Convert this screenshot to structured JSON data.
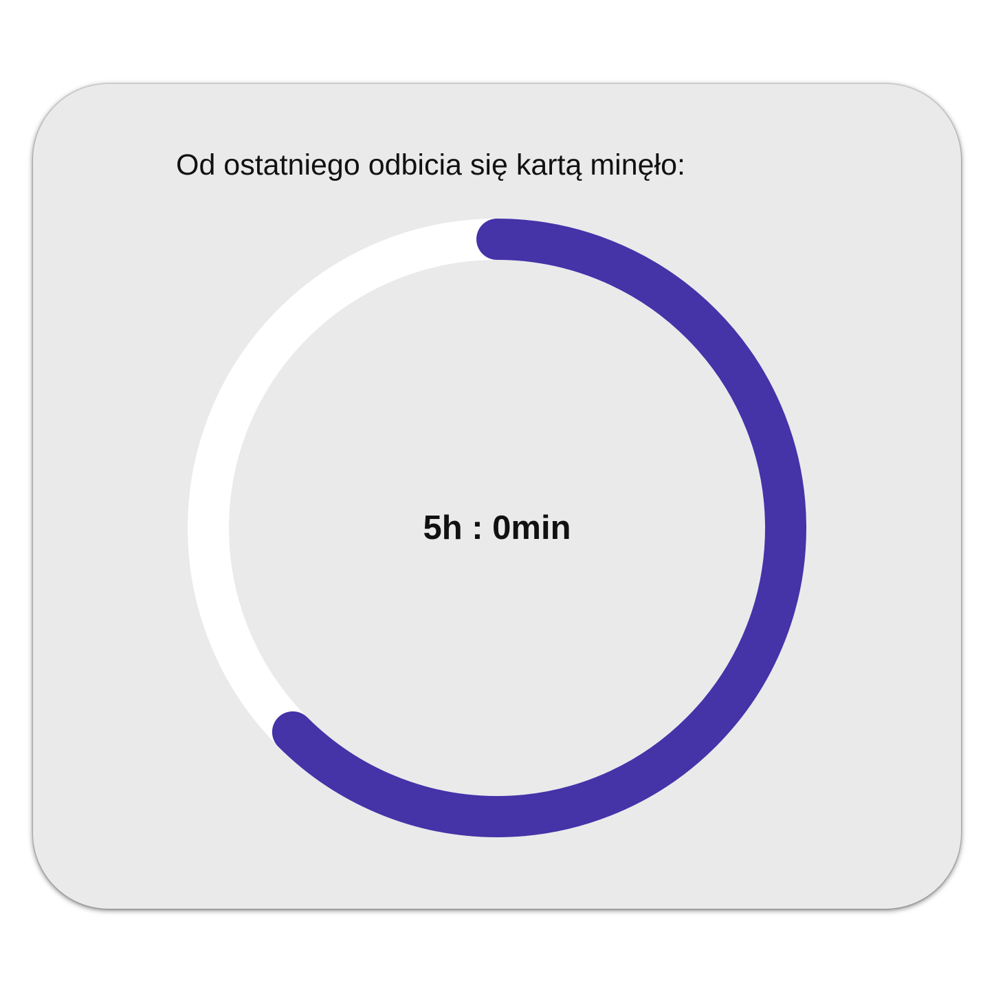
{
  "card": {
    "title": "Od ostatniego odbicia się kartą minęło:"
  },
  "timer": {
    "elapsed_text": "5h : 0min",
    "progress_fraction": 0.625
  },
  "colors": {
    "card_background": "#eaeaeb",
    "track": "#ffffff",
    "progress": "#4533a8",
    "text": "#111111"
  }
}
